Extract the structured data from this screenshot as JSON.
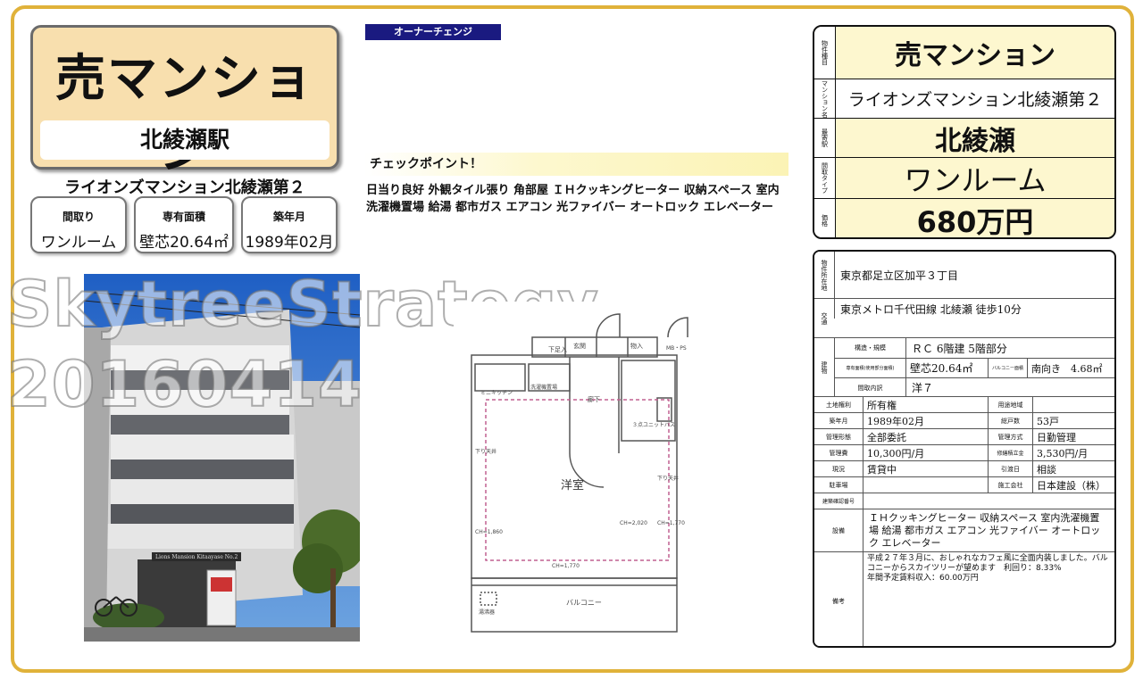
{
  "left": {
    "title": "売マンション",
    "station": "北綾瀬駅",
    "building_name": "ライオンズマンション北綾瀬第２",
    "chips": [
      {
        "label": "間取り",
        "value": "ワンルーム"
      },
      {
        "label": "専有面積",
        "value": "壁芯20.64㎡"
      },
      {
        "label": "築年月",
        "value": "1989年02月"
      }
    ]
  },
  "watermark": {
    "line1": "SkytreeStrategy",
    "line2": "20160414"
  },
  "middle": {
    "badge": "オーナーチェンジ",
    "checkpoint_title": "チェックポイント！",
    "checkpoint_text": "日当り良好 外観タイル張り 角部屋 ＩＨクッキングヒーター 収納スペース 室内洗濯機置場 給湯 都市ガス エアコン 光ファイバー オートロック エレベーター",
    "photo_sign": "Lions Mansion Kitaayase No.2",
    "plan_labels": {
      "geta": "下足入",
      "genkan": "玄関",
      "monoire": "物入",
      "mbps": "MB・PS",
      "kitchen": "ミニキッチン",
      "washer": "洗濯機置場",
      "rouka": "廊下",
      "unitbath": "３点ユニットバス",
      "youshitsu": "洋室",
      "balcony": "バルコニー",
      "kyuto": "湯沸器",
      "sagari1": "下り天井",
      "sagari2": "下り天井",
      "ch1": "CH=1,860",
      "ch2": "CH=2,020",
      "ch3": "CH=1,770",
      "ch4": "CH=1,770"
    }
  },
  "summary": [
    {
      "side": "物件種目",
      "value": "売マンション"
    },
    {
      "side": "マンション名",
      "value": "ライオンズマンション北綾瀬第２"
    },
    {
      "side": "最寄駅",
      "value": "北綾瀬"
    },
    {
      "side": "間取タイプ",
      "value": "ワンルーム"
    },
    {
      "side": "価格",
      "value": "680万円"
    }
  ],
  "detail": {
    "address_label": "物件所在地",
    "address": "東京都足立区加平３丁目",
    "traffic_label": "交通",
    "traffic": "東京メトロ千代田線 北綾瀬 徒歩10分",
    "bld_label": "建物",
    "structure_label": "構造・規模",
    "structure": "ＲＣ 6階建 5階部分",
    "area_label": "専有面積(使用部分面積)",
    "area": "壁芯20.64㎡",
    "balcony_label": "バルコニー面積",
    "balcony": "南向き　4.68㎡",
    "layout_label": "間取内訳",
    "layout": "洋７",
    "land_label": "土地権利",
    "land": "所有権",
    "zone_label": "用途地域",
    "zone": "",
    "built_label": "築年月",
    "built": "1989年02月",
    "units_label": "総戸数",
    "units": "53戸",
    "mgmt_form_label": "管理形態",
    "mgmt_form": "全部委託",
    "mgmt_method_label": "管理方式",
    "mgmt_method": "日勤管理",
    "mgmt_fee_label": "管理費",
    "mgmt_fee": "10,300円/月",
    "repair_label": "修繕積立金",
    "repair": "3,530円/月",
    "status_label": "現況",
    "status": "賃貸中",
    "handover_label": "引渡日",
    "handover": "相談",
    "parking_label": "駐車場",
    "parking": "",
    "builder_label": "施工会社",
    "builder": "日本建設（株）",
    "permit_label": "建築確認番号",
    "permit": "",
    "equip_label": "設備",
    "equip": "ＩＨクッキングヒーター 収納スペース 室内洗濯機置場 給湯 都市ガス エアコン 光ファイバー オートロック エレベーター",
    "remarks_label": "備考",
    "remarks": "平成２７年３月に、おしゃれなカフェ風に全面内装しました。バルコニーからスカイツリーが望めます　利回り：8.33%",
    "remarks2": "年間予定賃料収入：60.00万円"
  }
}
